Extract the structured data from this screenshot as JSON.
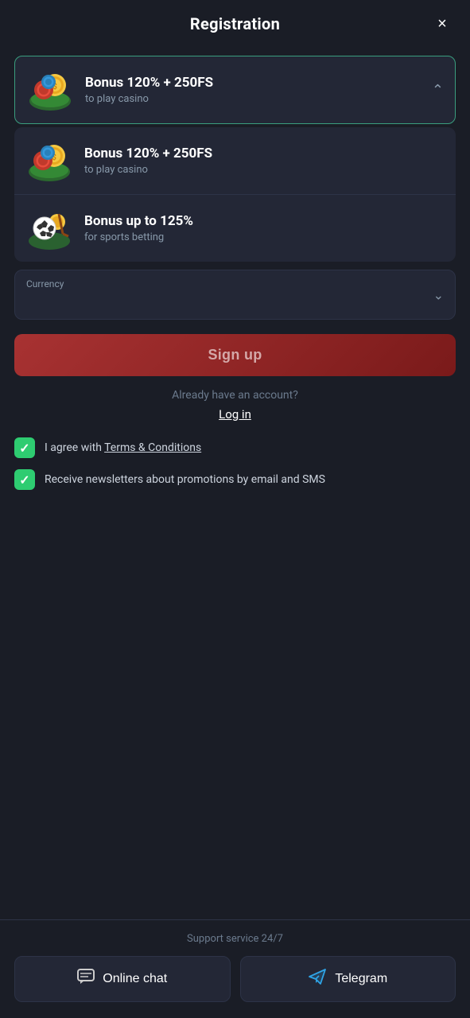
{
  "header": {
    "title": "Registration",
    "close_label": "×"
  },
  "bonuses": {
    "selected": {
      "title": "Bonus 120% + 250FS",
      "subtitle": "to play casino",
      "icon": "casino-chips"
    },
    "options": [
      {
        "title": "Bonus 120% + 250FS",
        "subtitle": "to play casino",
        "icon": "casino-chips"
      },
      {
        "title": "Bonus up to 125%",
        "subtitle": "for sports betting",
        "icon": "soccer-ball"
      }
    ]
  },
  "form": {
    "currency_label": "Currency",
    "currency_placeholder": "",
    "currency_chevron": "∨"
  },
  "buttons": {
    "signup_label": "Sign up",
    "login_prompt": "Already have an account?",
    "login_label": "Log in"
  },
  "checkboxes": [
    {
      "checked": true,
      "label_plain": "I agree with ",
      "label_link": "Terms & Conditions",
      "label_after": ""
    },
    {
      "checked": true,
      "label_plain": "Receive newsletters about promotions by email and SMS",
      "label_link": "",
      "label_after": ""
    }
  ],
  "footer": {
    "support_text": "Support service 24/7",
    "chat_label": "Online chat",
    "telegram_label": "Telegram"
  }
}
